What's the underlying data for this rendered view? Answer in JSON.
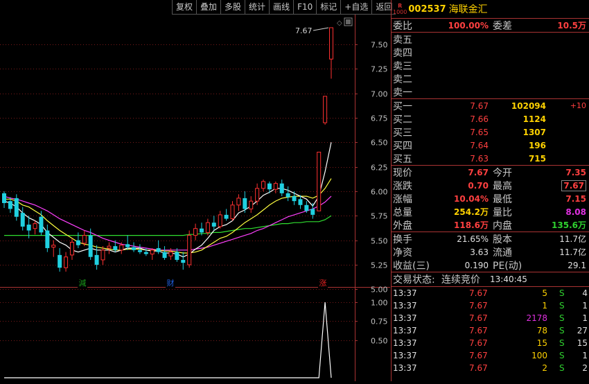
{
  "toolbar": {
    "buttons": [
      "复权",
      "叠加",
      "多股",
      "统计",
      "画线",
      "F10",
      "标记",
      "+自选",
      "返回"
    ]
  },
  "chart": {
    "price_axis_ticks": [
      "7.50",
      "7.25",
      "7.00",
      "6.75",
      "6.50",
      "6.25",
      "6.00",
      "5.75",
      "5.50",
      "5.25",
      "5.00"
    ],
    "volume_axis_ticks": [
      "1.00",
      "0.75",
      "0.50"
    ],
    "high_label": "7.67",
    "event_markers": [
      {
        "text": "減",
        "color": "#1a9a1a"
      },
      {
        "text": "财",
        "color": "#2060e0"
      },
      {
        "text": "涨",
        "color": "#e02020"
      }
    ],
    "colors": {
      "up": "#ff3030",
      "down": "#20d0e0",
      "ma5": "#ffffff",
      "ma10": "#ffff40",
      "ma20": "#ff40ff",
      "ma60": "#30e030",
      "grid": "#7a1a1a"
    }
  },
  "chart_data": {
    "type": "candlestick",
    "ylim": [
      5.0,
      7.75
    ],
    "candles": [
      {
        "o": 5.98,
        "h": 6.0,
        "l": 5.83,
        "c": 5.88
      },
      {
        "o": 5.9,
        "h": 5.94,
        "l": 5.78,
        "c": 5.82
      },
      {
        "o": 5.93,
        "h": 5.97,
        "l": 5.7,
        "c": 5.74
      },
      {
        "o": 5.78,
        "h": 5.84,
        "l": 5.6,
        "c": 5.64
      },
      {
        "o": 5.66,
        "h": 5.75,
        "l": 5.52,
        "c": 5.6
      },
      {
        "o": 5.62,
        "h": 5.7,
        "l": 5.56,
        "c": 5.67
      },
      {
        "o": 5.74,
        "h": 5.8,
        "l": 5.55,
        "c": 5.58
      },
      {
        "o": 5.6,
        "h": 5.66,
        "l": 5.38,
        "c": 5.42
      },
      {
        "o": 5.43,
        "h": 5.5,
        "l": 5.33,
        "c": 5.45
      },
      {
        "o": 5.35,
        "h": 5.42,
        "l": 5.18,
        "c": 5.22
      },
      {
        "o": 5.22,
        "h": 5.38,
        "l": 5.18,
        "c": 5.33
      },
      {
        "o": 5.35,
        "h": 5.52,
        "l": 5.3,
        "c": 5.48
      },
      {
        "o": 5.5,
        "h": 5.58,
        "l": 5.42,
        "c": 5.45
      },
      {
        "o": 5.47,
        "h": 5.6,
        "l": 5.44,
        "c": 5.55
      },
      {
        "o": 5.55,
        "h": 5.62,
        "l": 5.3,
        "c": 5.33
      },
      {
        "o": 5.35,
        "h": 5.45,
        "l": 5.2,
        "c": 5.25
      },
      {
        "o": 5.3,
        "h": 5.44,
        "l": 5.25,
        "c": 5.4
      },
      {
        "o": 5.42,
        "h": 5.48,
        "l": 5.36,
        "c": 5.44
      },
      {
        "o": 5.44,
        "h": 5.5,
        "l": 5.38,
        "c": 5.4
      },
      {
        "o": 5.4,
        "h": 5.48,
        "l": 5.36,
        "c": 5.45
      },
      {
        "o": 5.46,
        "h": 5.55,
        "l": 5.4,
        "c": 5.43
      },
      {
        "o": 5.43,
        "h": 5.48,
        "l": 5.38,
        "c": 5.4
      },
      {
        "o": 5.4,
        "h": 5.46,
        "l": 5.36,
        "c": 5.38
      },
      {
        "o": 5.38,
        "h": 5.42,
        "l": 5.34,
        "c": 5.36
      },
      {
        "o": 5.36,
        "h": 5.42,
        "l": 5.3,
        "c": 5.4
      },
      {
        "o": 5.42,
        "h": 5.5,
        "l": 5.36,
        "c": 5.38
      },
      {
        "o": 5.38,
        "h": 5.44,
        "l": 5.3,
        "c": 5.32
      },
      {
        "o": 5.34,
        "h": 5.42,
        "l": 5.3,
        "c": 5.38
      },
      {
        "o": 5.38,
        "h": 5.42,
        "l": 5.28,
        "c": 5.3
      },
      {
        "o": 5.3,
        "h": 5.38,
        "l": 5.2,
        "c": 5.27
      },
      {
        "o": 5.25,
        "h": 5.6,
        "l": 5.22,
        "c": 5.55
      },
      {
        "o": 5.55,
        "h": 5.67,
        "l": 5.5,
        "c": 5.62
      },
      {
        "o": 5.62,
        "h": 5.68,
        "l": 5.55,
        "c": 5.58
      },
      {
        "o": 5.58,
        "h": 5.72,
        "l": 5.55,
        "c": 5.68
      },
      {
        "o": 5.68,
        "h": 5.75,
        "l": 5.6,
        "c": 5.64
      },
      {
        "o": 5.64,
        "h": 5.8,
        "l": 5.62,
        "c": 5.76
      },
      {
        "o": 5.76,
        "h": 5.82,
        "l": 5.7,
        "c": 5.72
      },
      {
        "o": 5.72,
        "h": 5.9,
        "l": 5.7,
        "c": 5.86
      },
      {
        "o": 5.86,
        "h": 5.97,
        "l": 5.8,
        "c": 5.93
      },
      {
        "o": 5.93,
        "h": 6.0,
        "l": 5.78,
        "c": 5.82
      },
      {
        "o": 5.82,
        "h": 5.95,
        "l": 5.78,
        "c": 5.9
      },
      {
        "o": 5.9,
        "h": 6.08,
        "l": 5.86,
        "c": 6.03
      },
      {
        "o": 6.03,
        "h": 6.12,
        "l": 6.0,
        "c": 6.1
      },
      {
        "o": 6.08,
        "h": 6.1,
        "l": 5.98,
        "c": 6.02
      },
      {
        "o": 6.02,
        "h": 6.1,
        "l": 5.98,
        "c": 6.08
      },
      {
        "o": 6.08,
        "h": 6.12,
        "l": 5.95,
        "c": 5.98
      },
      {
        "o": 5.98,
        "h": 6.05,
        "l": 5.9,
        "c": 5.94
      },
      {
        "o": 5.95,
        "h": 6.0,
        "l": 5.86,
        "c": 5.9
      },
      {
        "o": 5.92,
        "h": 5.96,
        "l": 5.82,
        "c": 5.86
      },
      {
        "o": 5.86,
        "h": 5.9,
        "l": 5.78,
        "c": 5.8
      },
      {
        "o": 5.82,
        "h": 5.88,
        "l": 5.72,
        "c": 5.76
      },
      {
        "o": 5.8,
        "h": 6.4,
        "l": 5.8,
        "c": 6.4
      },
      {
        "o": 6.7,
        "h": 6.97,
        "l": 6.68,
        "c": 6.97
      },
      {
        "o": 7.35,
        "h": 7.67,
        "l": 7.15,
        "c": 7.67
      }
    ],
    "ma5": [
      5.9,
      5.88,
      5.84,
      5.78,
      5.73,
      5.7,
      5.66,
      5.58,
      5.53,
      5.48,
      5.45,
      5.4,
      5.38,
      5.4,
      5.42,
      5.4,
      5.4,
      5.4,
      5.38,
      5.4,
      5.42,
      5.42,
      5.42,
      5.4,
      5.39,
      5.39,
      5.37,
      5.37,
      5.36,
      5.33,
      5.36,
      5.41,
      5.45,
      5.52,
      5.6,
      5.64,
      5.66,
      5.7,
      5.78,
      5.81,
      5.85,
      5.9,
      5.96,
      5.99,
      6.03,
      6.03,
      6.01,
      5.98,
      5.95,
      5.92,
      5.85,
      5.95,
      6.2,
      6.5
    ],
    "ma10": [
      5.92,
      5.92,
      5.9,
      5.86,
      5.84,
      5.8,
      5.76,
      5.7,
      5.65,
      5.6,
      5.56,
      5.52,
      5.48,
      5.46,
      5.45,
      5.43,
      5.42,
      5.41,
      5.4,
      5.4,
      5.41,
      5.41,
      5.41,
      5.4,
      5.4,
      5.4,
      5.39,
      5.39,
      5.38,
      5.37,
      5.37,
      5.38,
      5.4,
      5.44,
      5.48,
      5.52,
      5.54,
      5.58,
      5.63,
      5.68,
      5.72,
      5.76,
      5.81,
      5.86,
      5.9,
      5.93,
      5.94,
      5.95,
      5.95,
      5.95,
      5.93,
      5.96,
      6.03,
      6.13
    ],
    "ma20": [
      5.95,
      5.93,
      5.92,
      5.9,
      5.88,
      5.86,
      5.83,
      5.8,
      5.76,
      5.72,
      5.69,
      5.66,
      5.63,
      5.6,
      5.58,
      5.55,
      5.52,
      5.5,
      5.48,
      5.46,
      5.45,
      5.44,
      5.43,
      5.42,
      5.41,
      5.4,
      5.4,
      5.4,
      5.4,
      5.4,
      5.4,
      5.41,
      5.42,
      5.43,
      5.45,
      5.47,
      5.49,
      5.51,
      5.53,
      5.55,
      5.57,
      5.6,
      5.62,
      5.65,
      5.68,
      5.71,
      5.74,
      5.76,
      5.78,
      5.8,
      5.82,
      5.85,
      5.89,
      5.95
    ],
    "ma60": [
      5.55,
      5.55,
      5.55,
      5.55,
      5.55,
      5.55,
      5.55,
      5.55,
      5.55,
      5.55,
      5.55,
      5.55,
      5.55,
      5.55,
      5.55,
      5.55,
      5.55,
      5.55,
      5.55,
      5.55,
      5.55,
      5.55,
      5.55,
      5.55,
      5.55,
      5.55,
      5.55,
      5.55,
      5.55,
      5.55,
      5.56,
      5.56,
      5.57,
      5.57,
      5.58,
      5.58,
      5.59,
      5.6,
      5.61,
      5.62,
      5.62,
      5.63,
      5.64,
      5.65,
      5.66,
      5.67,
      5.67,
      5.68,
      5.68,
      5.69,
      5.69,
      5.69,
      5.71,
      5.75
    ],
    "volume_indicator": {
      "ylim": [
        0,
        1.2
      ],
      "values": [
        0,
        0,
        0,
        0,
        0,
        0,
        0,
        0,
        0,
        0,
        0,
        0,
        0,
        0,
        0,
        0,
        0,
        0,
        0,
        0,
        0,
        0,
        0,
        0,
        0,
        0,
        0,
        0,
        0,
        0,
        0,
        0,
        0,
        0,
        0,
        0,
        0,
        0,
        0,
        0,
        0,
        0,
        0,
        0,
        0,
        0,
        0,
        0,
        0,
        0,
        0,
        0,
        1.0,
        0
      ]
    }
  },
  "quote": {
    "badge_top": "R",
    "badge_bottom": "1000",
    "code": "002537",
    "name": "海联金汇",
    "weibi_label": "委比",
    "weibi_value": "100.00%",
    "weicha_label": "委差",
    "weicha_value": "10.5万",
    "asks": [
      {
        "label": "卖五",
        "price": "",
        "vol": ""
      },
      {
        "label": "卖四",
        "price": "",
        "vol": ""
      },
      {
        "label": "卖三",
        "price": "",
        "vol": ""
      },
      {
        "label": "卖二",
        "price": "",
        "vol": ""
      },
      {
        "label": "卖一",
        "price": "",
        "vol": ""
      }
    ],
    "bids": [
      {
        "label": "买一",
        "price": "7.67",
        "vol": "102094",
        "chg": "+10"
      },
      {
        "label": "买二",
        "price": "7.66",
        "vol": "1124",
        "chg": ""
      },
      {
        "label": "买三",
        "price": "7.65",
        "vol": "1307",
        "chg": ""
      },
      {
        "label": "买四",
        "price": "7.64",
        "vol": "196",
        "chg": ""
      },
      {
        "label": "买五",
        "price": "7.63",
        "vol": "715",
        "chg": ""
      }
    ],
    "stats": [
      {
        "l1": "现价",
        "v1": "7.67",
        "c1": "red",
        "l2": "今开",
        "v2": "7.35",
        "c2": "red",
        "b2": false
      },
      {
        "l1": "涨跌",
        "v1": "0.70",
        "c1": "red",
        "l2": "最高",
        "v2": "7.67",
        "c2": "red",
        "b2": true
      },
      {
        "l1": "涨幅",
        "v1": "10.04%",
        "c1": "red",
        "l2": "最低",
        "v2": "7.15",
        "c2": "red",
        "b2": false
      },
      {
        "l1": "总量",
        "v1": "254.2万",
        "c1": "yel",
        "l2": "量比",
        "v2": "8.08",
        "c2": "mag",
        "b2": false
      },
      {
        "l1": "外盘",
        "v1": "118.6万",
        "c1": "red",
        "l2": "内盘",
        "v2": "135.6万",
        "c2": "grn",
        "b2": false
      }
    ],
    "info": [
      {
        "l1": "换手",
        "v1": "21.65%",
        "l2": "股本",
        "v2": "11.7亿"
      },
      {
        "l1": "净资",
        "v1": "3.63",
        "l2": "流通",
        "v2": "11.7亿"
      },
      {
        "l1": "收益(三)",
        "v1": "0.190",
        "l2": "PE(动)",
        "v2": "29.1"
      }
    ],
    "trade_status_label": "交易状态:",
    "trade_status_value": "连续竞价",
    "trade_status_time": "13:40:45",
    "ticks": [
      {
        "time": "13:37",
        "price": "7.67",
        "vol": "5",
        "vcolor": "yel",
        "side": "S",
        "count": "4"
      },
      {
        "time": "13:37",
        "price": "7.67",
        "vol": "1",
        "vcolor": "yel",
        "side": "S",
        "count": "1"
      },
      {
        "time": "13:37",
        "price": "7.67",
        "vol": "2178",
        "vcolor": "mag",
        "side": "S",
        "count": "1"
      },
      {
        "time": "13:37",
        "price": "7.67",
        "vol": "78",
        "vcolor": "yel",
        "side": "S",
        "count": "27"
      },
      {
        "time": "13:37",
        "price": "7.67",
        "vol": "15",
        "vcolor": "yel",
        "side": "S",
        "count": "15"
      },
      {
        "time": "13:37",
        "price": "7.67",
        "vol": "100",
        "vcolor": "yel",
        "side": "S",
        "count": "1"
      },
      {
        "time": "13:37",
        "price": "7.67",
        "vol": "2",
        "vcolor": "yel",
        "side": "S",
        "count": "2"
      }
    ]
  }
}
